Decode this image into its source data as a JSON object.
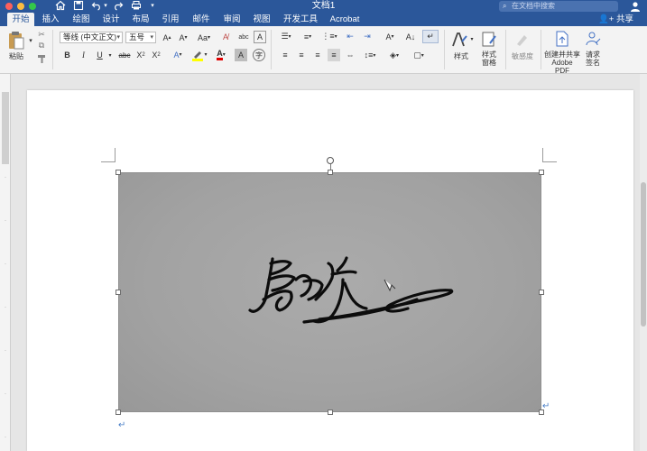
{
  "window": {
    "title": "文档1",
    "search_placeholder": "在文档中搜索"
  },
  "tabs": [
    {
      "label": "开始",
      "active": true
    },
    {
      "label": "插入"
    },
    {
      "label": "绘图"
    },
    {
      "label": "设计"
    },
    {
      "label": "布局"
    },
    {
      "label": "引用"
    },
    {
      "label": "邮件"
    },
    {
      "label": "审阅"
    },
    {
      "label": "视图"
    },
    {
      "label": "开发工具"
    },
    {
      "label": "Acrobat"
    }
  ],
  "share_label": "共享",
  "ribbon": {
    "paste_label": "粘贴",
    "font_name": "等线 (中文正文)",
    "font_size": "五号",
    "styles_label": "样式",
    "styles_pane_label_1": "样式",
    "styles_pane_label_2": "窗格",
    "sensitivity_label": "敏感度",
    "create_pdf_label_1": "创建并共享",
    "create_pdf_label_2": "Adobe PDF",
    "request_sign_label_1": "请求",
    "request_sign_label_2": "签名"
  },
  "colors": {
    "accent": "#2b579a",
    "highlight": "#ffff00",
    "font_color": "#e00000"
  }
}
